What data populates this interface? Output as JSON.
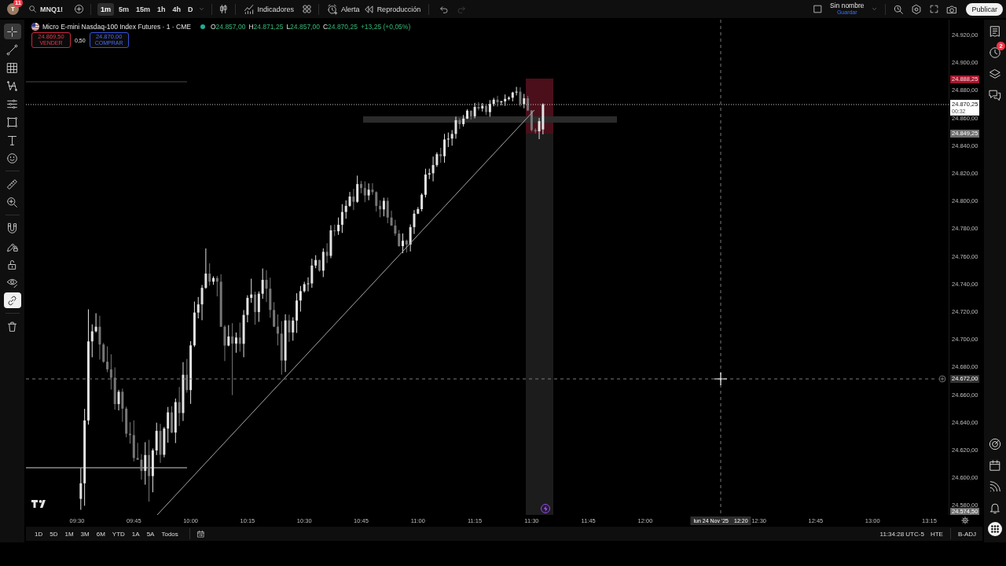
{
  "top_toolbar": {
    "avatar": {
      "initial": "T",
      "badge": "11"
    },
    "symbol": "MNQ1!",
    "intervals": [
      {
        "label": "1m",
        "selected": true
      },
      {
        "label": "5m",
        "selected": false
      },
      {
        "label": "15m",
        "selected": false
      },
      {
        "label": "1h",
        "selected": false
      },
      {
        "label": "4h",
        "selected": false
      },
      {
        "label": "D",
        "selected": false
      }
    ],
    "actions": [
      {
        "kind": "indicators",
        "label": "Indicadores"
      },
      {
        "kind": "alert",
        "label": "Alerta"
      },
      {
        "kind": "replay",
        "label": "Reproducción"
      }
    ],
    "history": [
      {
        "kind": "undo",
        "disabled": false
      },
      {
        "kind": "redo",
        "disabled": true
      }
    ],
    "layout": {
      "name": "Sin nombre",
      "save_label": "Guardar"
    },
    "publish_button": "Publicar"
  },
  "left_toolbar": {
    "drawing_tools": [
      {
        "kind": "crosshair",
        "selected": true
      },
      {
        "kind": "trend-line",
        "selected": false
      },
      {
        "kind": "grid",
        "selected": false
      },
      {
        "kind": "zigzag",
        "selected": false
      },
      {
        "kind": "lines",
        "selected": false
      },
      {
        "kind": "rectangle",
        "selected": false
      },
      {
        "kind": "text",
        "selected": false
      },
      {
        "kind": "smiley",
        "selected": false
      }
    ],
    "measure_tools": [
      {
        "kind": "ruler",
        "selected": false
      },
      {
        "kind": "zoom",
        "selected": false
      }
    ],
    "toggles": [
      {
        "kind": "magnet",
        "on": false
      },
      {
        "kind": "pencil-lock",
        "on": false
      },
      {
        "kind": "unlock",
        "on": false
      },
      {
        "kind": "eye",
        "on": false
      },
      {
        "kind": "link",
        "on": true
      }
    ]
  },
  "chart": {
    "legend": {
      "title": "Micro E-mini Nasdaq-100 Index Futures · 1 · CME",
      "market_open": true,
      "ohlc": [
        {
          "key": "O",
          "value": "24.857,00"
        },
        {
          "key": "H",
          "value": "24.871,25"
        },
        {
          "key": "L",
          "value": "24.857,00"
        },
        {
          "key": "C",
          "value": "24.870,25"
        }
      ],
      "change": "+13,25 (+0,05%)"
    },
    "trade": {
      "sell_price": "24.869,50",
      "sell_label": "VENDER",
      "spread": "0,50",
      "buy_price": "24.870,00",
      "buy_label": "COMPRAR"
    }
  },
  "price_axis": {
    "labels": [
      "24.920,00",
      "24.900,00",
      "24.880,00",
      "24.860,00",
      "24.840,00",
      "24.820,00",
      "24.800,00",
      "24.780,00",
      "24.760,00",
      "24.740,00",
      "24.720,00",
      "24.700,00",
      "24.680,00",
      "24.660,00",
      "24.640,00",
      "24.620,00",
      "24.600,00",
      "24.580,00"
    ],
    "markers": [
      {
        "kind": "stop",
        "value": "24.888,25"
      },
      {
        "kind": "last",
        "value": "24.870,25",
        "countdown": "00:32"
      },
      {
        "kind": "entry",
        "value": "24.849,25"
      },
      {
        "kind": "crosshair",
        "value": "24.672,00"
      },
      {
        "kind": "low",
        "value": "24.574,50"
      }
    ]
  },
  "time_axis": {
    "labels": [
      "09:30",
      "09:45",
      "10:00",
      "10:15",
      "10:30",
      "10:45",
      "11:00",
      "11:15",
      "11:30",
      "11:45",
      "12:00",
      "12:30",
      "12:45",
      "13:00",
      "13:15"
    ],
    "crosshair_date": "lun 24 Nov '25",
    "crosshair_time": "12:20"
  },
  "right_sidebar": {
    "top": [
      {
        "kind": "watchlist"
      },
      {
        "kind": "alerts",
        "badge": "2"
      },
      {
        "kind": "layers"
      },
      {
        "kind": "chat"
      }
    ],
    "bottom": [
      {
        "kind": "target"
      },
      {
        "kind": "calendar"
      },
      {
        "kind": "signal"
      },
      {
        "kind": "bell"
      },
      {
        "kind": "apps"
      }
    ]
  },
  "bottom_bar": {
    "ranges": [
      "1D",
      "5D",
      "1M",
      "3M",
      "6M",
      "YTD",
      "1A",
      "5A",
      "Todos"
    ],
    "clock": "11:34:28 UTC-5",
    "session": "HTE",
    "adjustment": "B-ADJ"
  }
}
